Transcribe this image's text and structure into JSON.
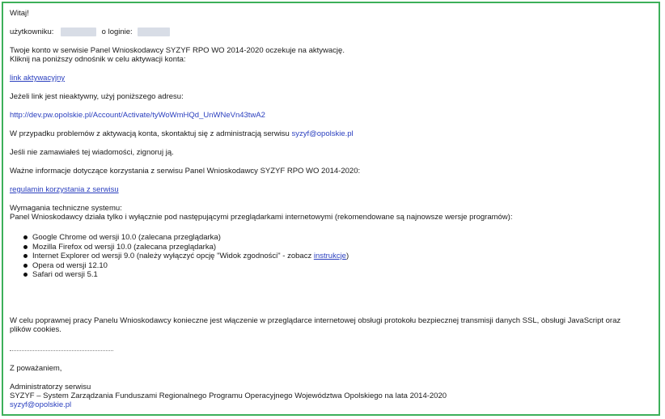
{
  "email": {
    "greeting": "Witaj!",
    "user_label": "użytkowniku:",
    "login_label": "o loginie:",
    "account_text": "Twoje konto w serwisie Panel Wnioskodawcy SYZYF RPO WO 2014-2020 oczekuje na aktywację.",
    "click_text": "Kliknij na poniższy odnośnik w celu aktywacji konta:",
    "activation_link": "link aktywacyjny",
    "inactive_text": "Jeżeli link jest nieaktywny, użyj poniższego adresu:",
    "activation_url": "http://dev.pw.opolskie.pl/Account/Activate/tyWoWmHQd_UnWNeVn43twA2",
    "problem_text": "W przypadku problemów z aktywacją konta, skontaktuj się z administracją serwisu",
    "admin_email": "syzyf@opolskie.pl",
    "ignore_text": "Jeśli nie zamawiałeś tej wiadomości, zignoruj ją.",
    "important_text": "Ważne informacje dotyczące korzystania z serwisu Panel Wnioskodawcy SYZYF RPO WO 2014-2020:",
    "regulations_link": "regulamin korzystania z serwisu",
    "tech_req_title": "Wymagania techniczne systemu:",
    "tech_req_text": "Panel Wnioskodawcy działa tylko i wyłącznie pod następującymi przeglądarkami internetowymi (rekomendowane są najnowsze wersje programów):",
    "browsers": [
      "Google Chrome od wersji 10.0 (zalecana przeglądarka)",
      "Mozilla Firefox od wersji 10.0 (zalecana przeglądarka)",
      "Internet Explorer od wersji 9.0 (należy wyłączyć opcję \"Widok zgodności\" - zobacz ",
      "Opera od wersji 12.10",
      "Safari od wersji 5.1"
    ],
    "instructions_link": "instrukcje",
    "ie_suffix": ")",
    "ssl_text_1": "W celu poprawnej pracy Panelu Wnioskodawcy konieczne jest włączenie w przeglądarce internetowej obsługi protokołu bezpiecznej transmisji danych SSL, obsługi JavaScript oraz",
    "ssl_text_2": "plików cookies.",
    "regards": "Z poważaniem,",
    "signature_1": "Administratorzy serwisu",
    "signature_2": "SYZYF – System Zarządzania Funduszami Regionalnego Programu Operacyjnego  Województwa Opolskiego na lata 2014-2020",
    "signature_email": "syzyf@opolskie.pl"
  },
  "colors": {
    "frame": "#3db05a",
    "link": "#2a3fbf",
    "redaction": "#d8dde6"
  }
}
